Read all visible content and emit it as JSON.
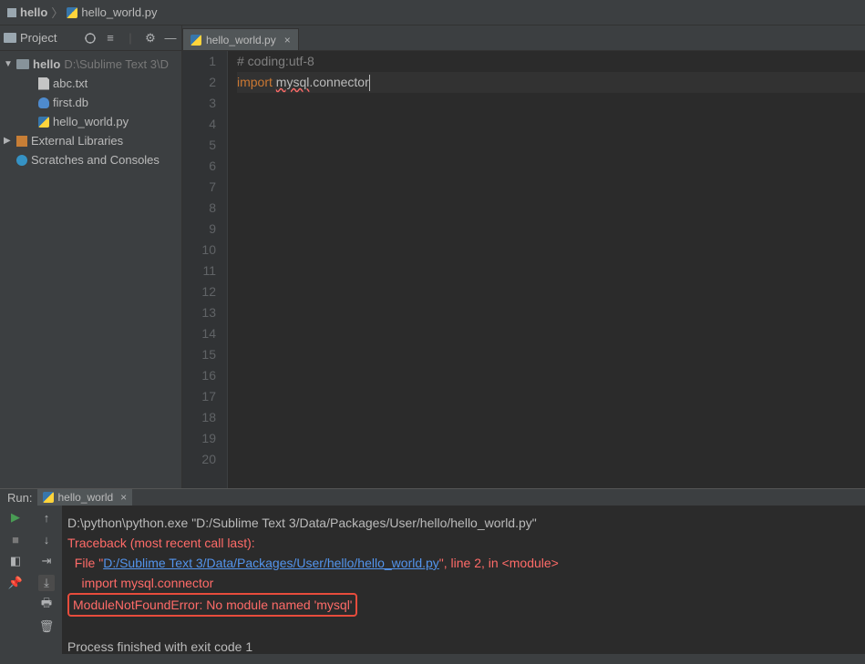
{
  "breadcrumb": {
    "root": "hello",
    "file": "hello_world.py"
  },
  "project_panel": {
    "title": "Project",
    "root": {
      "name": "hello",
      "path": "D:\\Sublime Text 3\\D"
    },
    "files": [
      {
        "name": "abc.txt",
        "kind": "text"
      },
      {
        "name": "first.db",
        "kind": "db"
      },
      {
        "name": "hello_world.py",
        "kind": "py"
      }
    ],
    "external": "External Libraries",
    "scratches": "Scratches and Consoles"
  },
  "editor": {
    "tab": "hello_world.py",
    "lines": [
      {
        "n": 1,
        "raw": "# coding:utf-8",
        "type": "comment"
      },
      {
        "n": 2,
        "kw": "import ",
        "err": "mysql",
        "rest": ".connector",
        "type": "import",
        "caret": true
      },
      {
        "n": 3
      },
      {
        "n": 4
      },
      {
        "n": 5
      },
      {
        "n": 6
      },
      {
        "n": 7
      },
      {
        "n": 8
      },
      {
        "n": 9
      },
      {
        "n": 10
      },
      {
        "n": 11
      },
      {
        "n": 12
      },
      {
        "n": 13
      },
      {
        "n": 14
      },
      {
        "n": 15
      },
      {
        "n": 16
      },
      {
        "n": 17
      },
      {
        "n": 18
      },
      {
        "n": 19
      },
      {
        "n": 20
      }
    ]
  },
  "run": {
    "title": "Run:",
    "tab": "hello_world",
    "cmd": "D:\\python\\python.exe \"D:/Sublime Text 3/Data/Packages/User/hello/hello_world.py\"",
    "trace1": "Traceback (most recent call last):",
    "trace2a": "  File \"",
    "trace2link": "D:/Sublime Text 3/Data/Packages/User/hello/hello_world.py",
    "trace2b": "\", line 2, in <module>",
    "trace3": "    import mysql.connector",
    "error": "ModuleNotFoundError: No module named 'mysql'",
    "exit": "Process finished with exit code 1"
  }
}
